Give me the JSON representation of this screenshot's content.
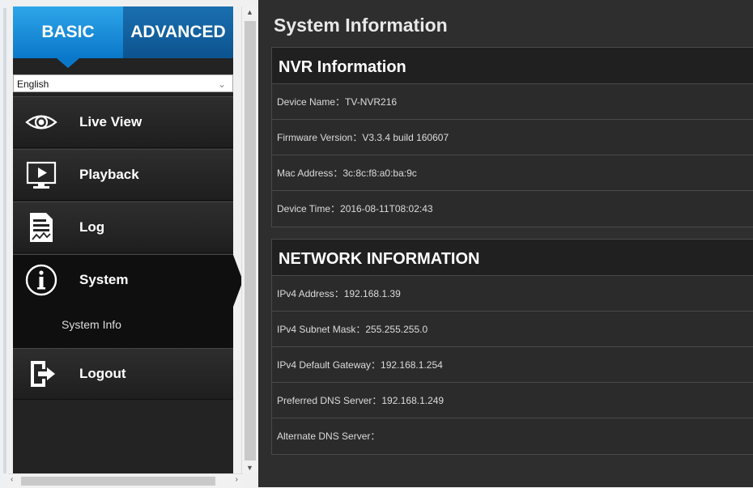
{
  "tabs": {
    "basic": "BASIC",
    "advanced": "ADVANCED"
  },
  "language": {
    "selected": "English"
  },
  "nav": {
    "live_view": "Live View",
    "playback": "Playback",
    "log": "Log",
    "system": "System",
    "system_info": "System Info",
    "logout": "Logout"
  },
  "page": {
    "title": "System Information"
  },
  "nvr": {
    "heading": "NVR Information",
    "rows": [
      "Device Name：TV-NVR216",
      "Firmware Version：V3.3.4 build 160607",
      "Mac Address：3c:8c:f8:a0:ba:9c",
      "Device Time：2016-08-11T08:02:43"
    ]
  },
  "network": {
    "heading": "NETWORK INFORMATION",
    "rows": [
      "IPv4 Address：192.168.1.39",
      "IPv4 Subnet Mask：255.255.255.0",
      "IPv4 Default Gateway：192.168.1.254",
      "Preferred DNS Server：192.168.1.249",
      "Alternate DNS Server："
    ]
  },
  "colors": {
    "accent": "#0a78c9",
    "sidebar": "#232323",
    "main": "#2e2e2e"
  }
}
